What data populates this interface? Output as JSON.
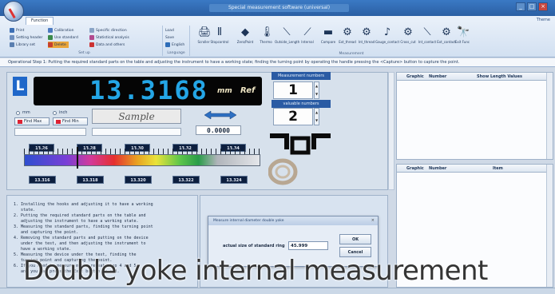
{
  "window": {
    "title": "Special measurement software (universal)",
    "minimize": "_",
    "maximize": "□",
    "close": "×"
  },
  "ribbon": {
    "active_tab": "Function",
    "right_menu": "Theme",
    "group1": {
      "items": [
        "Print",
        "Setting header",
        "Library set",
        "Calibration",
        "Use standard",
        "Delete",
        "Specific direction",
        "Statistical analysis",
        "Data and others"
      ],
      "caption": "Set up"
    },
    "group2": {
      "items": [
        "Load",
        "Save",
        "English"
      ],
      "caption": "Language"
    },
    "big_buttons": [
      {
        "label": "Scroller",
        "icon": "🖨"
      },
      {
        "label": "Stopcontrol",
        "icon": "Ⅱ"
      },
      {
        "label": "Zero/Point",
        "icon": "◆"
      },
      {
        "label": "Thermo",
        "icon": "🌡"
      },
      {
        "label": "Outside_Length",
        "icon": "⟍"
      },
      {
        "label": "Internal",
        "icon": "⟋"
      },
      {
        "label": "Compare",
        "icon": "▬"
      },
      {
        "label": "Ext_thread",
        "icon": "⚙"
      },
      {
        "label": "Int_thread",
        "icon": "⚙"
      },
      {
        "label": "Gauge_contact",
        "icon": "♪"
      },
      {
        "label": "Cross_cut",
        "icon": "⚙"
      },
      {
        "label": "Int_contact",
        "icon": "⟍"
      },
      {
        "label": "Ext_contact",
        "icon": "⚙"
      },
      {
        "label": "Exit Func",
        "icon": "🔭"
      }
    ],
    "measure_caption": "Measurement"
  },
  "instruction": "Operational Step 1: Putting the required standard parts on the table and adjusting the instrument to have a working state; finding the turning point by operating the handle pressing the <Capture> button to capture the point.",
  "display": {
    "axis_label": "L",
    "value": "13.3168",
    "unit": "mm",
    "ref": "Ref"
  },
  "counters": {
    "measurement_label": "Measurement numbers",
    "measurement_value": "1",
    "valuable_label": "valuable numbers",
    "valuable_value": "2"
  },
  "options": {
    "mm": "mm",
    "inch": "inch",
    "find_max": "Find Max",
    "find_min": "Find Min"
  },
  "sample_label": "Sample",
  "deviation_value": "0.0000",
  "scale_ticks_top": [
    "13.26",
    "13.28",
    "13.30",
    "13.32",
    "13.34"
  ],
  "scale_ticks_bottom": [
    "13.316",
    "13.318",
    "13.320",
    "13.322",
    "13.324"
  ],
  "table_top": {
    "headers": [
      "Graphic",
      "Number",
      "Show Length Values"
    ]
  },
  "table_bottom": {
    "headers": [
      "Graphic",
      "Number",
      "Item"
    ]
  },
  "steps": [
    "1. Installing the hooks and adjusting it to have a working",
    "   state.",
    "2. Putting the required standard parts on the table and",
    "   adjusting the instrument to have a working state.",
    "3. Measuring the standard parts, finding the turning point",
    "   and capturing the point.",
    "4. Removing the standard parts and putting on the device",
    "   under the test, and then adjusting the instrument to",
    "   have a working state.",
    "5. Measuring the device under the test, finding the",
    "   turning point and capturing the point.",
    "6. If you need to measure more, repeat step 4 and 5,",
    "   and you can press the Exit button to end."
  ],
  "dialog": {
    "title": "Measure internal diameter double yoke",
    "close": "×",
    "field_label": "actual size of standard ring",
    "field_value": "45.999",
    "ok": "OK",
    "cancel": "Cancel"
  },
  "caption": "Double yoke internal measurement",
  "colors": {
    "display_value": "#24a6e6",
    "axis_badge": "#1f67c9",
    "label_bar": "#2a5ba4"
  }
}
